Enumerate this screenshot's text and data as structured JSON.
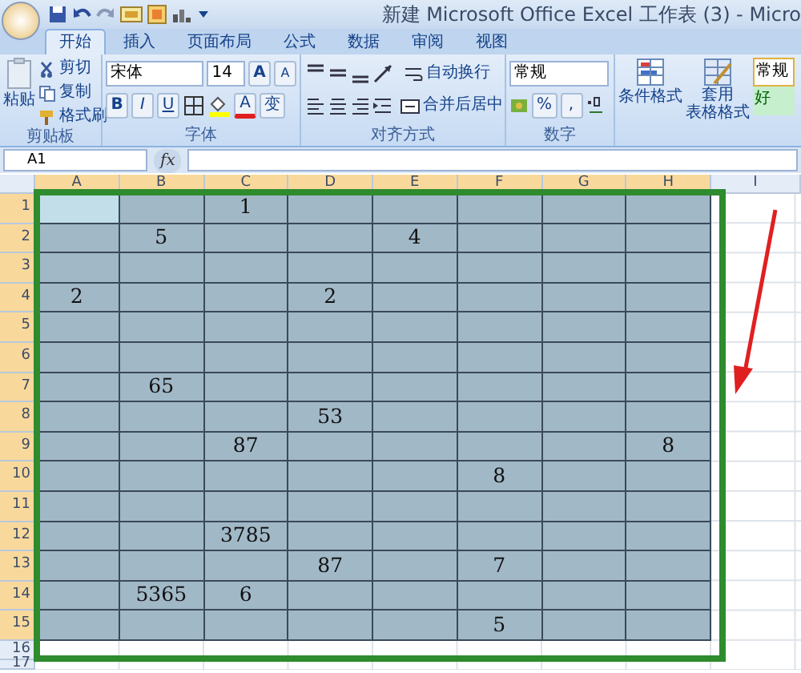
{
  "window": {
    "title": "新建 Microsoft Office Excel 工作表 (3) - Micro"
  },
  "tabs": [
    {
      "label": "开始",
      "selected": true
    },
    {
      "label": "插入",
      "selected": false
    },
    {
      "label": "页面布局",
      "selected": false
    },
    {
      "label": "公式",
      "selected": false
    },
    {
      "label": "数据",
      "selected": false
    },
    {
      "label": "审阅",
      "selected": false
    },
    {
      "label": "视图",
      "selected": false
    }
  ],
  "ribbon": {
    "clipboard": {
      "paste": "粘贴",
      "cut": "剪切",
      "copy": "复制",
      "format_painter": "格式刷",
      "label": "剪贴板"
    },
    "font": {
      "name": "宋体",
      "size": "14",
      "grow": "A",
      "shrink": "A",
      "bold": "B",
      "italic": "I",
      "underline": "U",
      "font_color": "A",
      "phonetic": "变",
      "label": "字体"
    },
    "alignment": {
      "wrap_text": "自动换行",
      "merge": "合并后居中",
      "label": "对齐方式"
    },
    "number": {
      "format": "常规",
      "percent": "%",
      "comma": ",",
      "label": "数字"
    },
    "styles": {
      "conditional": "条件格式",
      "table_format": [
        "套用",
        "表格格式"
      ],
      "gallery": [
        "常规",
        "好"
      ]
    }
  },
  "formula_bar": {
    "name_box": "A1",
    "function_label": "fx"
  },
  "sheet": {
    "columns": [
      {
        "label": "A",
        "selected": true
      },
      {
        "label": "B",
        "selected": true
      },
      {
        "label": "C",
        "selected": true
      },
      {
        "label": "D",
        "selected": true
      },
      {
        "label": "E",
        "selected": true
      },
      {
        "label": "F",
        "selected": true
      },
      {
        "label": "G",
        "selected": true
      },
      {
        "label": "H",
        "selected": true
      },
      {
        "label": "I",
        "selected": false
      }
    ],
    "rows": [
      {
        "label": "1",
        "selected": true,
        "cells": [
          {
            "active": true
          },
          {
            "active": false
          },
          {
            "text": "1",
            "active": false
          },
          {
            "active": false
          },
          {
            "active": false
          },
          {
            "active": false
          },
          {
            "active": false
          },
          {
            "active": false
          }
        ]
      },
      {
        "label": "2",
        "selected": true,
        "cells": [
          {
            "active": false
          },
          {
            "text": "5",
            "active": false
          },
          {
            "active": false
          },
          {
            "active": false
          },
          {
            "text": "4",
            "active": false
          },
          {
            "active": false
          },
          {
            "active": false
          },
          {
            "active": false
          }
        ]
      },
      {
        "label": "3",
        "selected": true,
        "cells": [
          {
            "active": false
          },
          {
            "active": false
          },
          {
            "active": false
          },
          {
            "active": false
          },
          {
            "active": false
          },
          {
            "active": false
          },
          {
            "active": false
          },
          {
            "active": false
          }
        ]
      },
      {
        "label": "4",
        "selected": true,
        "cells": [
          {
            "text": "2",
            "active": false
          },
          {
            "active": false
          },
          {
            "active": false
          },
          {
            "text": "2",
            "active": false
          },
          {
            "active": false
          },
          {
            "active": false
          },
          {
            "active": false
          },
          {
            "active": false
          }
        ]
      },
      {
        "label": "5",
        "selected": true,
        "cells": [
          {
            "active": false
          },
          {
            "active": false
          },
          {
            "active": false
          },
          {
            "active": false
          },
          {
            "active": false
          },
          {
            "active": false
          },
          {
            "active": false
          },
          {
            "active": false
          }
        ]
      },
      {
        "label": "6",
        "selected": true,
        "cells": [
          {
            "active": false
          },
          {
            "active": false
          },
          {
            "active": false
          },
          {
            "active": false
          },
          {
            "active": false
          },
          {
            "active": false
          },
          {
            "active": false
          },
          {
            "active": false
          }
        ]
      },
      {
        "label": "7",
        "selected": true,
        "cells": [
          {
            "active": false
          },
          {
            "text": "65",
            "active": false
          },
          {
            "active": false
          },
          {
            "active": false
          },
          {
            "active": false
          },
          {
            "active": false
          },
          {
            "active": false
          },
          {
            "active": false
          }
        ]
      },
      {
        "label": "8",
        "selected": true,
        "cells": [
          {
            "active": false
          },
          {
            "active": false
          },
          {
            "active": false
          },
          {
            "text": "53",
            "active": false
          },
          {
            "active": false
          },
          {
            "active": false
          },
          {
            "active": false
          },
          {
            "active": false
          }
        ]
      },
      {
        "label": "9",
        "selected": true,
        "cells": [
          {
            "active": false
          },
          {
            "active": false
          },
          {
            "text": "87",
            "active": false
          },
          {
            "active": false
          },
          {
            "active": false
          },
          {
            "active": false
          },
          {
            "active": false
          },
          {
            "text": "8",
            "active": false
          }
        ]
      },
      {
        "label": "10",
        "selected": true,
        "cells": [
          {
            "active": false
          },
          {
            "active": false
          },
          {
            "active": false
          },
          {
            "active": false
          },
          {
            "active": false
          },
          {
            "text": "8",
            "active": false
          },
          {
            "active": false
          },
          {
            "active": false
          }
        ]
      },
      {
        "label": "11",
        "selected": true,
        "cells": [
          {
            "active": false
          },
          {
            "active": false
          },
          {
            "active": false
          },
          {
            "active": false
          },
          {
            "active": false
          },
          {
            "active": false
          },
          {
            "active": false
          },
          {
            "active": false
          }
        ]
      },
      {
        "label": "12",
        "selected": true,
        "cells": [
          {
            "active": false
          },
          {
            "active": false
          },
          {
            "text": "3785",
            "active": false
          },
          {
            "active": false
          },
          {
            "active": false
          },
          {
            "active": false
          },
          {
            "active": false
          },
          {
            "active": false
          }
        ]
      },
      {
        "label": "13",
        "selected": true,
        "cells": [
          {
            "active": false
          },
          {
            "active": false
          },
          {
            "active": false
          },
          {
            "text": "87",
            "active": false
          },
          {
            "active": false
          },
          {
            "text": "7",
            "active": false
          },
          {
            "active": false
          },
          {
            "active": false
          }
        ]
      },
      {
        "label": "14",
        "selected": true,
        "cells": [
          {
            "active": false
          },
          {
            "text": "5365",
            "active": false
          },
          {
            "text": "6",
            "active": false
          },
          {
            "active": false
          },
          {
            "active": false
          },
          {
            "active": false
          },
          {
            "active": false
          },
          {
            "active": false
          }
        ]
      },
      {
        "label": "15",
        "selected": true,
        "cells": [
          {
            "active": false
          },
          {
            "active": false
          },
          {
            "active": false
          },
          {
            "active": false
          },
          {
            "active": false
          },
          {
            "text": "5",
            "active": false
          },
          {
            "active": false
          },
          {
            "active": false
          }
        ]
      },
      {
        "label": "16",
        "selected": false
      },
      {
        "label": "17",
        "selected": false
      }
    ]
  }
}
